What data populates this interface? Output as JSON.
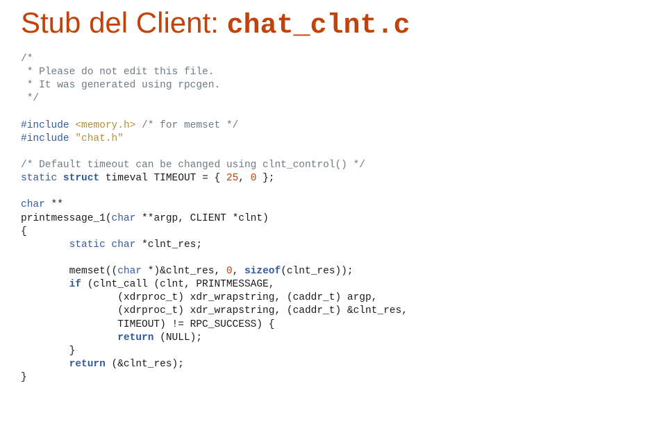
{
  "title": {
    "sans": "Stub del Client: ",
    "mono": "chat_clnt.c"
  },
  "code": {
    "c1": "/*",
    "c2": " * Please do not edit this file.",
    "c3": " * It was generated using rpcgen.",
    "c4": " */",
    "inc1a": "#include",
    "inc1b": " <memory.h> ",
    "inc1c": "/* for memset */",
    "inc2a": "#include",
    "inc2b": " \"chat.h\"",
    "dt": "/* Default timeout can be changed using clnt_control() */",
    "st1a": "static",
    "st1b": " struct",
    "st1c": " timeval TIMEOUT = { ",
    "st1d": "25",
    "st1e": ", ",
    "st1f": "0",
    "st1g": " };",
    "ch1a": "char",
    "ch1b": " **",
    "pm1a": "printmessage_1(",
    "pm1b": "char",
    "pm1c": " **argp, CLIENT *clnt)",
    "ob": "{",
    "sc1a": "        static",
    "sc1b": " char",
    "sc1c": " *clnt_res;",
    "ms1a": "        memset((",
    "ms1b": "char",
    "ms1c": " *)&clnt_res, ",
    "ms1d": "0",
    "ms1e": ", ",
    "ms1f": "sizeof",
    "ms1g": "(clnt_res));",
    "if1a": "        if",
    "if1b": " (clnt_call (clnt, PRINTMESSAGE,",
    "x1": "                (xdrproc_t) xdr_wrapstring, (caddr_t) argp,",
    "x2": "                (xdrproc_t) xdr_wrapstring, (caddr_t) &clnt_res,",
    "x3": "                TIMEOUT) != RPC_SUCCESS) {",
    "r1a": "                return",
    "r1b": " (NULL);",
    "cb1": "        }",
    "r2a": "        return",
    "r2b": " (&clnt_res);",
    "cb2": "}"
  }
}
